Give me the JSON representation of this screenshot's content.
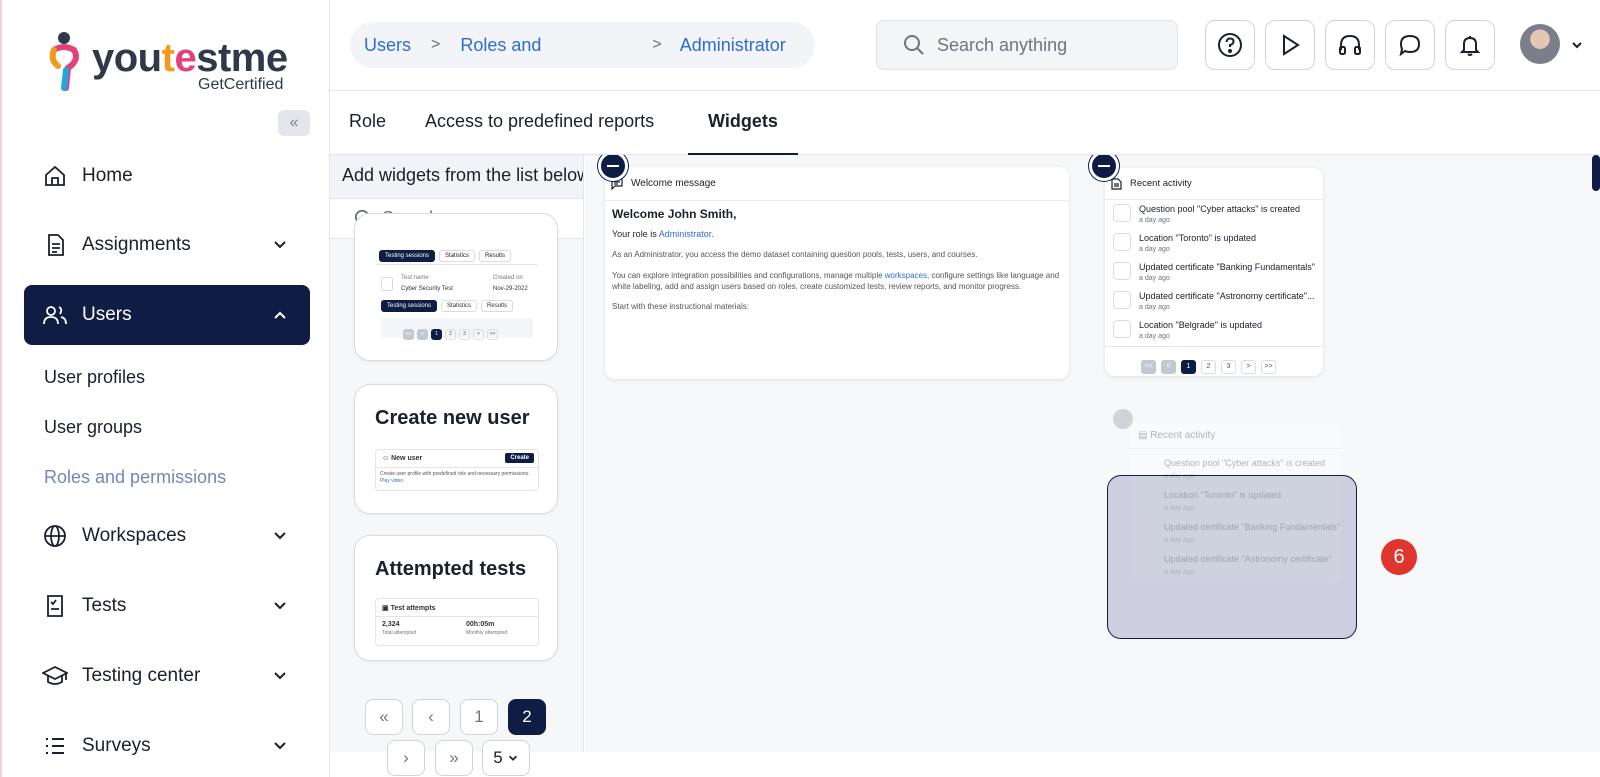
{
  "brand": {
    "word_a": "you",
    "word_b": "t",
    "word_c": "e",
    "word_d": "stme",
    "tagline": "GetCertified"
  },
  "sidebar": {
    "collapse_glyph": "«",
    "items": [
      {
        "label": "Home",
        "icon": "home-icon"
      },
      {
        "label": "Assignments",
        "icon": "assignments-icon"
      },
      {
        "label": "Users",
        "icon": "users-icon",
        "active": true
      },
      {
        "label": "Workspaces",
        "icon": "globe-icon"
      },
      {
        "label": "Tests",
        "icon": "tests-icon"
      },
      {
        "label": "Testing center",
        "icon": "graduation-cap-icon"
      },
      {
        "label": "Surveys",
        "icon": "list-icon"
      }
    ],
    "sub_items": [
      "User profiles",
      "User groups",
      "Roles and permissions"
    ]
  },
  "header": {
    "breadcrumb": [
      "Users",
      "Roles and",
      "Administrator"
    ],
    "breadcrumb_sep": ">",
    "search_placeholder": "Search anything"
  },
  "tabs": [
    "Role",
    "Access to predefined reports",
    "Widgets"
  ],
  "widget_panel": {
    "heading": "Add widgets from the list below",
    "search_placeholder": "Search",
    "card1": {
      "pill1": "Testing sessions",
      "pill2": "Statistics",
      "pill3": "Results",
      "test_name_label": "Test name",
      "test_name": "Cyber Security Test",
      "created_label": "Created on",
      "created": "Nov-29-2022",
      "pages": [
        "<<",
        "<",
        "1",
        "2",
        "3",
        ">",
        ">>"
      ]
    },
    "card2": {
      "title": "Create new user",
      "row_label": "New user",
      "button": "Create",
      "desc": "Create user profile with predefined role and necessary permissions.",
      "link": "Play video"
    },
    "card3": {
      "title": "Attempted tests",
      "header": "Test attempts",
      "v1": "2,324",
      "l1": "Total attempted",
      "v2": "00h:05m",
      "l2": "Monthly attempted"
    },
    "pager": {
      "first": "«",
      "prev": "‹",
      "p1": "1",
      "p2": "2",
      "next": "›",
      "last": "»",
      "per_page": "5"
    }
  },
  "welcome": {
    "title": "Welcome message",
    "greeting": "Welcome John Smith,",
    "role_prefix": "Your role is ",
    "role": "Administrator.",
    "p1": "As an Administrator, you access the demo dataset containing question pools, tests, users, and courses.",
    "p2a": "You can explore integration possibilities and configurations, manage multiple ",
    "p2link": "workspaces",
    "p2b": ", configure settings like language and white labeling, add and assign users based on roles, create customized tests, review reports, and monitor progress.",
    "p3": "Start with these instructional materials:"
  },
  "recent": {
    "title": "Recent activity",
    "rows": [
      {
        "t": "Question pool \"Cyber attacks\" is created",
        "d": "a day ago"
      },
      {
        "t": "Location \"Toronto\" is updated",
        "d": "a day ago"
      },
      {
        "t": "Updated certificate \"Banking Fundamentals\"",
        "d": "a day ago"
      },
      {
        "t": "Updated certificate \"Astronomy certificate\"...",
        "d": "a day ago"
      },
      {
        "t": "Location \"Belgrade\" is updated",
        "d": "a day ago"
      }
    ],
    "pages": [
      "<<",
      "<",
      "1",
      "2",
      "3",
      ">",
      ">>"
    ]
  },
  "ghost": {
    "title": "Recent activity",
    "rows": [
      {
        "t": "Question pool \"Cyber attacks\" is created",
        "d": "a day ago"
      },
      {
        "t": "Location \"Toronto\" is updated",
        "d": "a day ago"
      },
      {
        "t": "Updated certificate \"Banking Fundamentals\"",
        "d": "a day ago"
      },
      {
        "t": "Updated certificate \"Astronomy certificate\"",
        "d": "a day ago"
      }
    ]
  },
  "step_badge": "6"
}
